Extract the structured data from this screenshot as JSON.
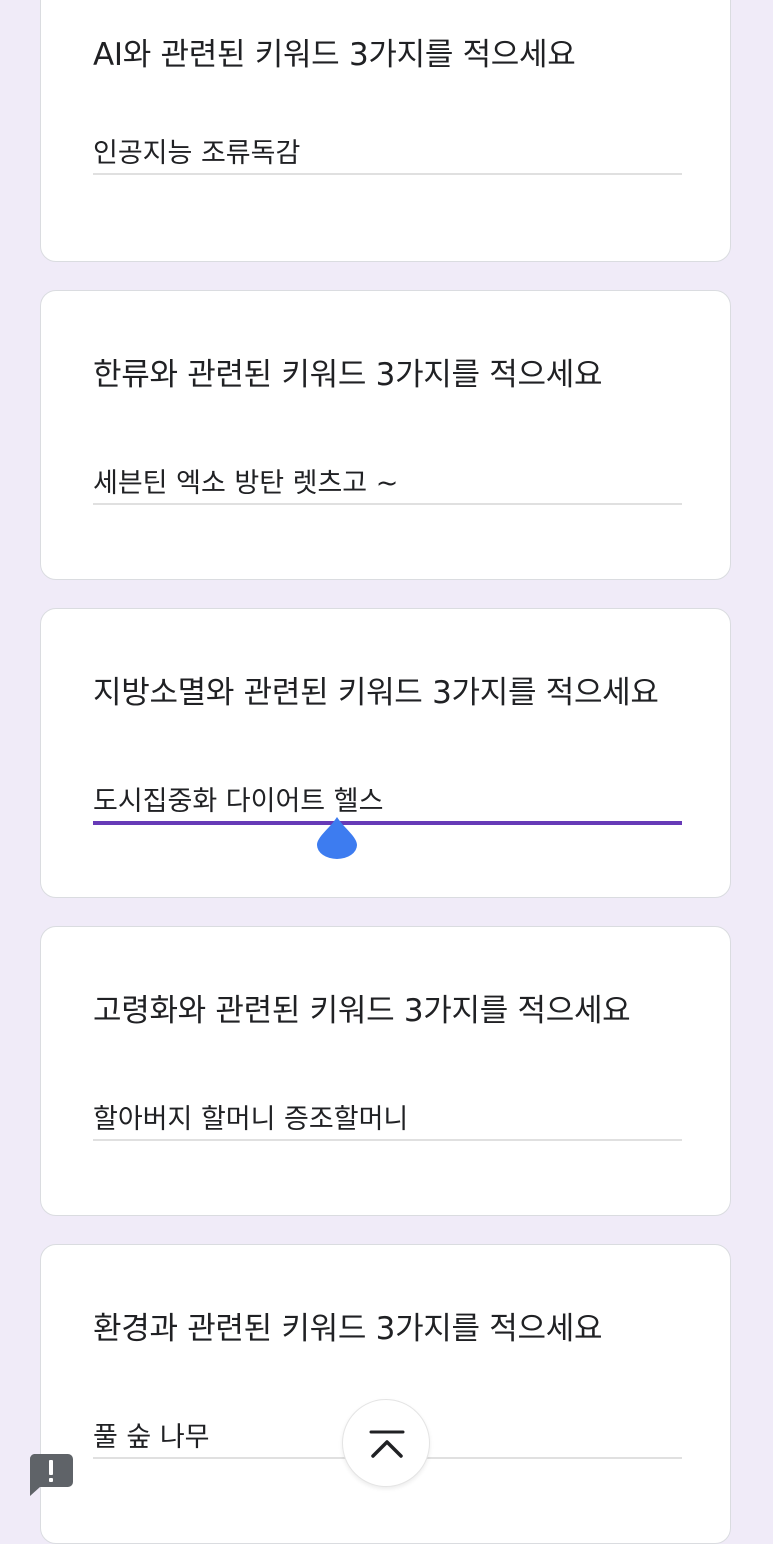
{
  "questions": [
    {
      "label": "AI와 관련된 키워드 3가지를 적으세요",
      "answer": "인공지능 조류독감"
    },
    {
      "label": "한류와 관련된 키워드 3가지를 적으세요",
      "answer": "세븐틴 엑소 방탄 렛츠고 ~"
    },
    {
      "label": "지방소멸와 관련된 키워드 3가지를 적으세요",
      "answer": "도시집중화 다이어트 헬스"
    },
    {
      "label": "고령화와 관련된 키워드 3가지를 적으세요",
      "answer": "할아버지 할머니 증조할머니"
    },
    {
      "label": "환경과 관련된 키워드 3가지를 적으세요",
      "answer": "풀 숲 나무"
    }
  ],
  "colors": {
    "background": "#f0ebf8",
    "accent": "#673ab7",
    "cursor_handle": "#3d7cf0"
  },
  "icons": {
    "scroll_top": "chevron-up-icon",
    "report": "report-issue-icon",
    "cursor": "text-cursor-handle-icon"
  }
}
